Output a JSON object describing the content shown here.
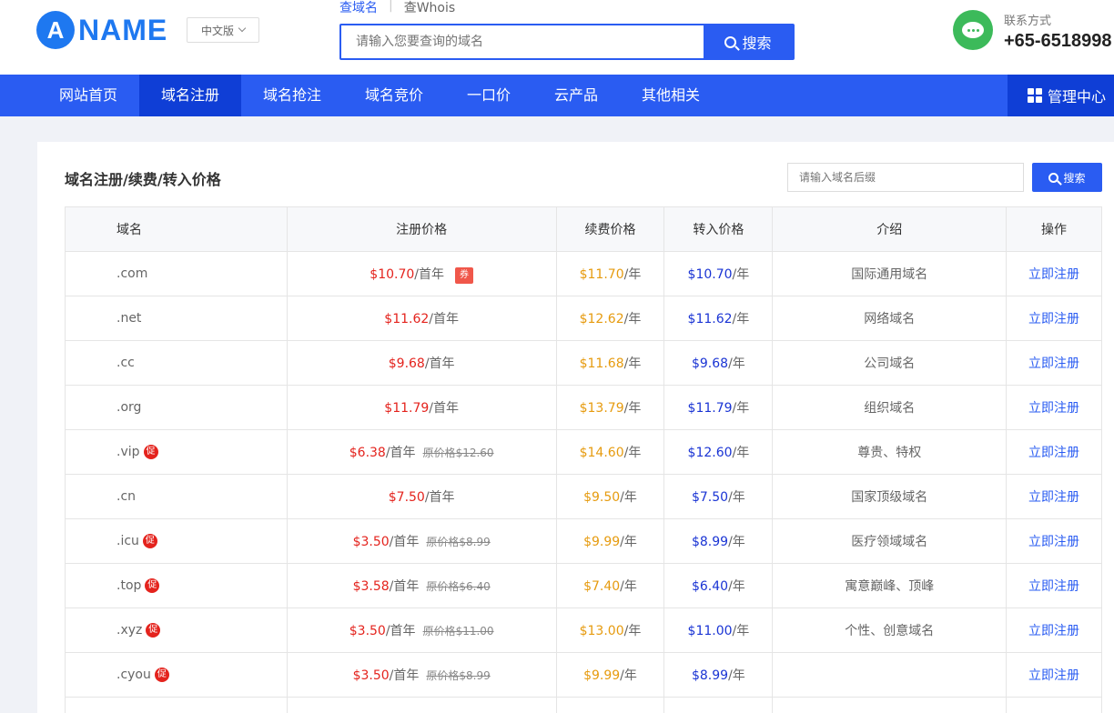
{
  "header": {
    "logo_mark": "A",
    "logo_text": "NAME",
    "language": "中文版",
    "search_tabs": [
      "查域名",
      "查Whois"
    ],
    "search_placeholder": "请输入您要查询的域名",
    "search_button": "搜索",
    "contact_label": "联系方式",
    "contact_phone": "+65-6518998"
  },
  "nav": {
    "items": [
      "网站首页",
      "域名注册",
      "域名抢注",
      "域名竞价",
      "一口价",
      "云产品",
      "其他相关"
    ],
    "active_index": 1,
    "admin": "管理中心"
  },
  "panel": {
    "title": "域名注册/续费/转入价格",
    "suffix_placeholder": "请输入域名后缀",
    "search_button": "搜索"
  },
  "table": {
    "headers": [
      "域名",
      "注册价格",
      "续费价格",
      "转入价格",
      "介绍",
      "操作"
    ],
    "first_year_unit": "/首年",
    "year_unit": "/年",
    "action_label": "立即注册",
    "promo_badge": "促",
    "coupon_badge": "券",
    "rows": [
      {
        "domain": ".com",
        "promo": "",
        "reg": "$10.70",
        "orig": "",
        "coupon": "券",
        "renew": "$11.70",
        "transfer": "$10.70",
        "intro": "国际通用域名"
      },
      {
        "domain": ".net",
        "promo": "",
        "reg": "$11.62",
        "orig": "",
        "coupon": "",
        "renew": "$12.62",
        "transfer": "$11.62",
        "intro": "网络域名"
      },
      {
        "domain": ".cc",
        "promo": "",
        "reg": "$9.68",
        "orig": "",
        "coupon": "",
        "renew": "$11.68",
        "transfer": "$9.68",
        "intro": "公司域名"
      },
      {
        "domain": ".org",
        "promo": "",
        "reg": "$11.79",
        "orig": "",
        "coupon": "",
        "renew": "$13.79",
        "transfer": "$11.79",
        "intro": "组织域名"
      },
      {
        "domain": ".vip",
        "promo": "促",
        "reg": "$6.38",
        "orig": "原价格$12.60",
        "coupon": "",
        "renew": "$14.60",
        "transfer": "$12.60",
        "intro": "尊贵、特权"
      },
      {
        "domain": ".cn",
        "promo": "",
        "reg": "$7.50",
        "orig": "",
        "coupon": "",
        "renew": "$9.50",
        "transfer": "$7.50",
        "intro": "国家顶级域名"
      },
      {
        "domain": ".icu",
        "promo": "促",
        "reg": "$3.50",
        "orig": "原价格$8.99",
        "coupon": "",
        "renew": "$9.99",
        "transfer": "$8.99",
        "intro": "医疗领域域名"
      },
      {
        "domain": ".top",
        "promo": "促",
        "reg": "$3.58",
        "orig": "原价格$6.40",
        "coupon": "",
        "renew": "$7.40",
        "transfer": "$6.40",
        "intro": "寓意巅峰、顶峰"
      },
      {
        "domain": ".xyz",
        "promo": "促",
        "reg": "$3.50",
        "orig": "原价格$11.00",
        "coupon": "",
        "renew": "$13.00",
        "transfer": "$11.00",
        "intro": "个性、创意域名"
      },
      {
        "domain": ".cyou",
        "promo": "促",
        "reg": "$3.50",
        "orig": "原价格$8.99",
        "coupon": "",
        "renew": "$9.99",
        "transfer": "$8.99",
        "intro": ""
      },
      {
        "domain": "",
        "promo": "",
        "reg": "",
        "orig": "",
        "coupon": "",
        "renew": "",
        "transfer": "",
        "intro": ""
      }
    ]
  },
  "colors": {
    "primary": "#2a5cf2",
    "nav_active": "#0f3ed6",
    "price_red": "#e4231d",
    "price_orange": "#e69b0f",
    "price_blue": "#1a34d4",
    "contact_green": "#3cba5a"
  },
  "icons": [
    "search-icon",
    "chevron-down-icon",
    "wechat-icon",
    "grid-icon"
  ]
}
